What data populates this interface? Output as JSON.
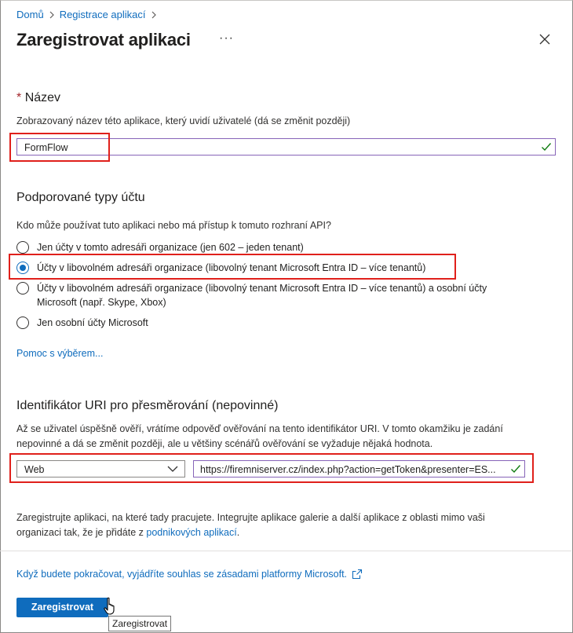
{
  "breadcrumb": {
    "home": "Domů",
    "app_registrations": "Registrace aplikací"
  },
  "header": {
    "title": "Zaregistrovat aplikaci",
    "more_label": "···"
  },
  "name_section": {
    "required_mark": "*",
    "title": "Název",
    "description": "Zobrazovaný název této aplikace, který uvidí uživatelé (dá se změnit později)",
    "value": "FormFlow"
  },
  "account_types": {
    "title": "Podporované typy účtu",
    "question": "Kdo může používat tuto aplikaci nebo má přístup k tomuto rozhraní API?",
    "options": [
      {
        "label": "Jen účty v tomto adresáři organizace (jen 602 – jeden tenant)",
        "selected": false
      },
      {
        "label": "Účty v libovolném adresáři organizace (libovolný tenant Microsoft Entra ID – více tenantů)",
        "selected": true
      },
      {
        "label_line1": "Účty v libovolném adresáři organizace (libovolný tenant Microsoft Entra ID – více tenantů) a osobní účty",
        "label_line2": "Microsoft (např. Skype, Xbox)",
        "selected": false
      },
      {
        "label": "Jen osobní účty Microsoft",
        "selected": false
      }
    ],
    "help_link": "Pomoc s výběrem..."
  },
  "redirect": {
    "title": "Identifikátor URI pro přesměrování (nepovinné)",
    "description_line1": "Až se uživatel úspěšně ověří, vrátíme odpověď ověřování na tento identifikátor URI. V tomto okamžiku je zadání",
    "description_line2": "nepovinné a dá se změnit později, ale u většiny scénářů ověřování se vyžaduje nějaká hodnota.",
    "platform": "Web",
    "uri": "https://firemniserver.cz/index.php?action=getToken&presenter=ES..."
  },
  "footer_note": {
    "line1": "Zaregistrujte aplikaci, na které tady pracujete. Integrujte aplikace galerie a další aplikace z oblasti mimo vaši",
    "line2_prefix": "organizaci tak, že je přidáte z",
    "line2_link": "podnikových aplikací",
    "line2_suffix": "."
  },
  "policy_link": "Když budete pokračovat, vyjádříte souhlas se zásadami platformy Microsoft.",
  "register_button": "Zaregistrovat",
  "tooltip": "Zaregistrovat",
  "colors": {
    "accent": "#0f6cbd",
    "highlight": "#e0201b",
    "valid": "#107c10"
  }
}
